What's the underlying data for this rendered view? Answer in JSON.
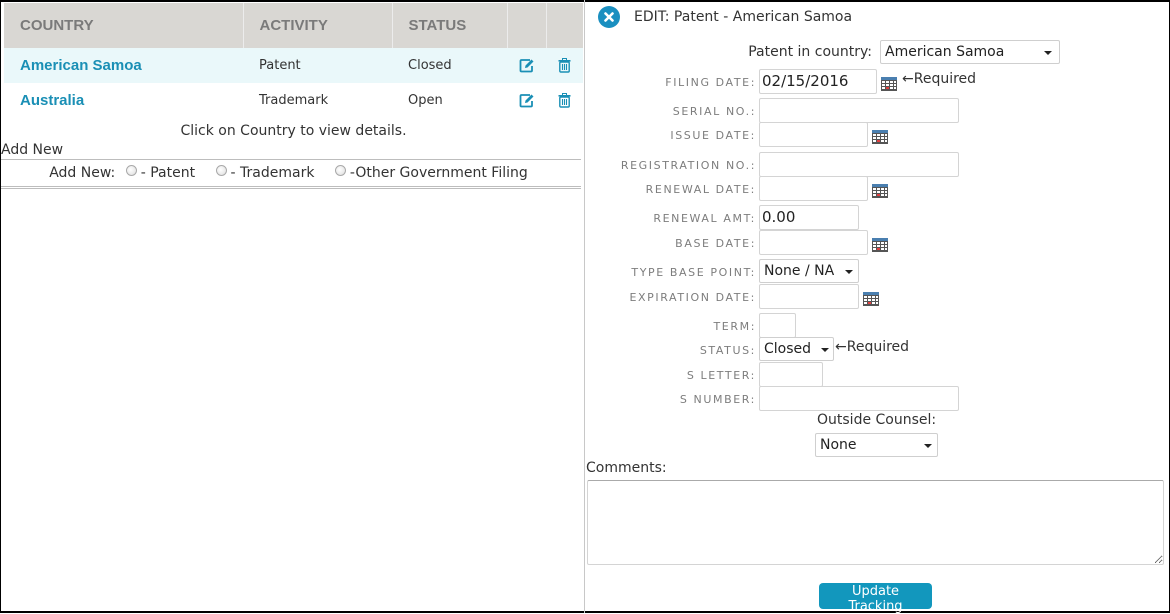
{
  "grid": {
    "columns": [
      "COUNTRY",
      "ACTIVITY",
      "STATUS",
      "",
      ""
    ],
    "rows": [
      {
        "country": "American Samoa",
        "activity": "Patent",
        "status": "Closed",
        "edit_icon": "edit-icon",
        "delete_icon": "trash-icon"
      },
      {
        "country": "Australia",
        "activity": "Trademark",
        "status": "Open",
        "edit_icon": "edit-icon",
        "delete_icon": "trash-icon"
      }
    ],
    "hint": "Click on Country to view details."
  },
  "add_new": {
    "title": "Add New",
    "prompt": "Add New:",
    "options": [
      "- Patent",
      "- Trademark",
      "-Other Government Filing"
    ]
  },
  "edit": {
    "close_icon": "close-circle-icon",
    "title": "EDIT: Patent - American Samoa",
    "country_label": "Patent in country:",
    "country_value": "American Samoa",
    "required_text": "←Required",
    "fields": {
      "filing_date": {
        "label": "FILING DATE:",
        "value": "02/15/2016"
      },
      "serial_no": {
        "label": "SERIAL NO.:",
        "value": ""
      },
      "issue_date": {
        "label": "ISSUE DATE:",
        "value": ""
      },
      "registration_no": {
        "label": "REGISTRATION NO.:",
        "value": ""
      },
      "renewal_date": {
        "label": "RENEWAL DATE:",
        "value": ""
      },
      "renewal_amt": {
        "label": "RENEWAL AMT:",
        "value": "0.00"
      },
      "base_date": {
        "label": "BASE DATE:",
        "value": ""
      },
      "type_base_point": {
        "label": "TYPE BASE POINT:",
        "value": "None / NA"
      },
      "expiration_date": {
        "label": "EXPIRATION DATE:",
        "value": ""
      },
      "term": {
        "label": "TERM:",
        "value": ""
      },
      "status": {
        "label": "STATUS:",
        "value": "Closed"
      },
      "s_letter": {
        "label": "S LETTER:",
        "value": ""
      },
      "s_number": {
        "label": "S NUMBER:",
        "value": ""
      }
    },
    "outside_counsel_label": "Outside Counsel:",
    "outside_counsel_value": "None",
    "comments_label": "Comments:",
    "comments_value": "",
    "update_button": "Update Tracking",
    "calendar_icon": "calendar-icon"
  },
  "colors": {
    "accent": "#1a8fb5",
    "button": "#1297bd",
    "header_bg": "#d9d7d3",
    "selected_row_bg": "#eaf8fa"
  }
}
